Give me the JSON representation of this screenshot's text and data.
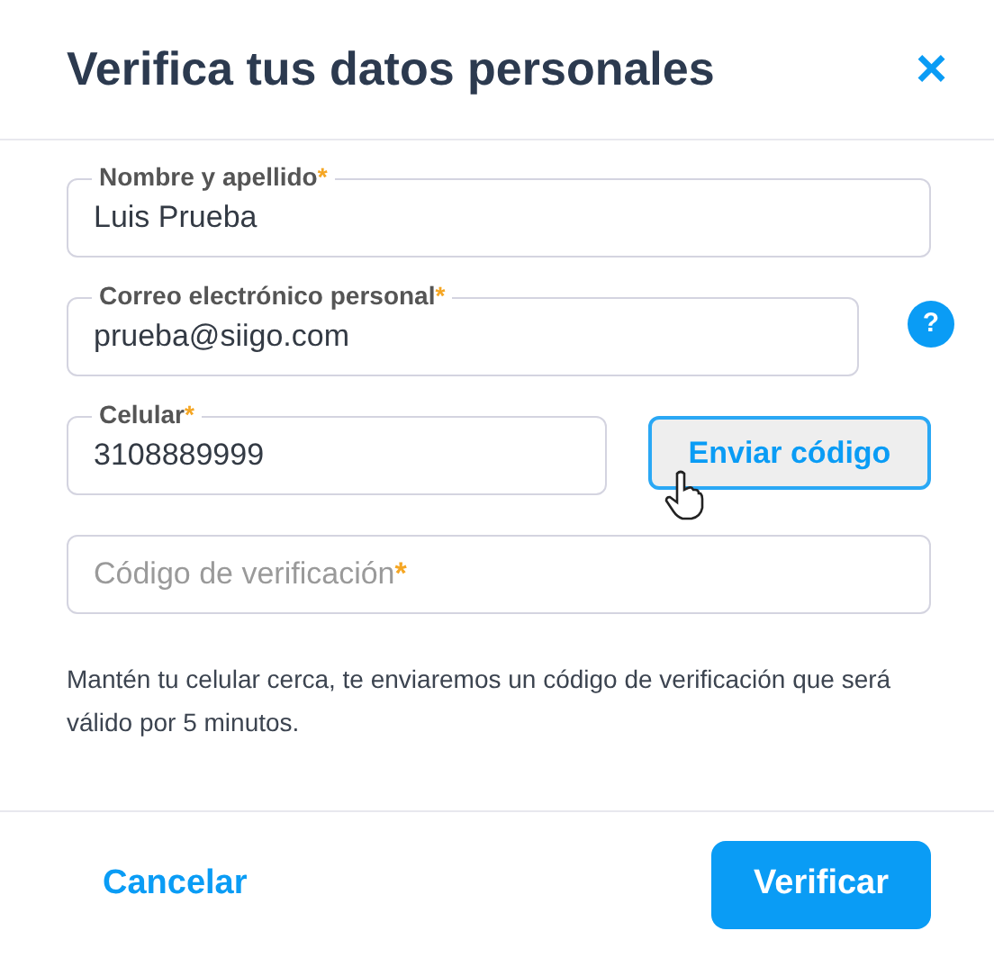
{
  "dialog": {
    "title": "Verifica tus datos personales",
    "close": "×"
  },
  "fields": [
    {
      "kind": "text",
      "label": "Nombre y apellido",
      "marker": "*",
      "value": "Luis Prueba"
    },
    {
      "kind": "help",
      "label": "Correo electrónico personal",
      "marker": "*",
      "value": "prueba@siigo.com",
      "help": "?"
    },
    {
      "kind": "send",
      "label": "Celular",
      "marker": "*",
      "value": "3108889999",
      "button": {
        "label": "Enviar código",
        "hovered": true
      }
    },
    {
      "kind": "empty",
      "placeholder": "Código de verificación",
      "marker": "*"
    }
  ],
  "note": "Mantén tu celular cerca, te enviaremos un código de verificación que será válido por 5 minutos.",
  "footer": {
    "cancel": "Cancelar",
    "confirm": "Verificar"
  }
}
